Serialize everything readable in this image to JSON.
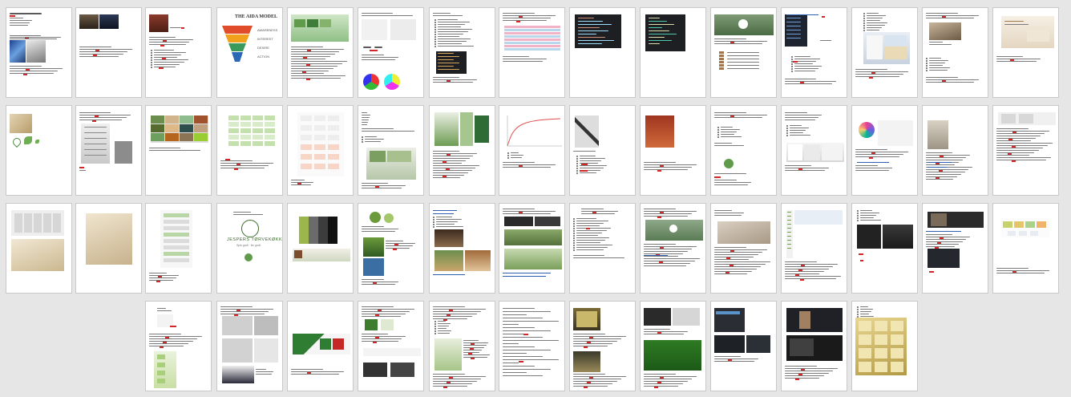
{
  "window": {
    "title": ""
  },
  "thumbnails": {
    "p4_title": "THE AIDA MODEL",
    "p4_labels": [
      "AWARENESS",
      "INTEREST",
      "DESIRE",
      "ACTION"
    ],
    "p49_brand": "JESPERS TØRVEKØKKEN",
    "p49_tagline": "Spis godt · lev godt"
  },
  "colors": {
    "background": "#e6e6e6",
    "page": "#ffffff",
    "text": "#5a5a5a",
    "spellcheck": "#d02828",
    "link": "#2f5fb3",
    "brand_green": "#6b9a3a",
    "dark_editor": "#1e1f22"
  }
}
